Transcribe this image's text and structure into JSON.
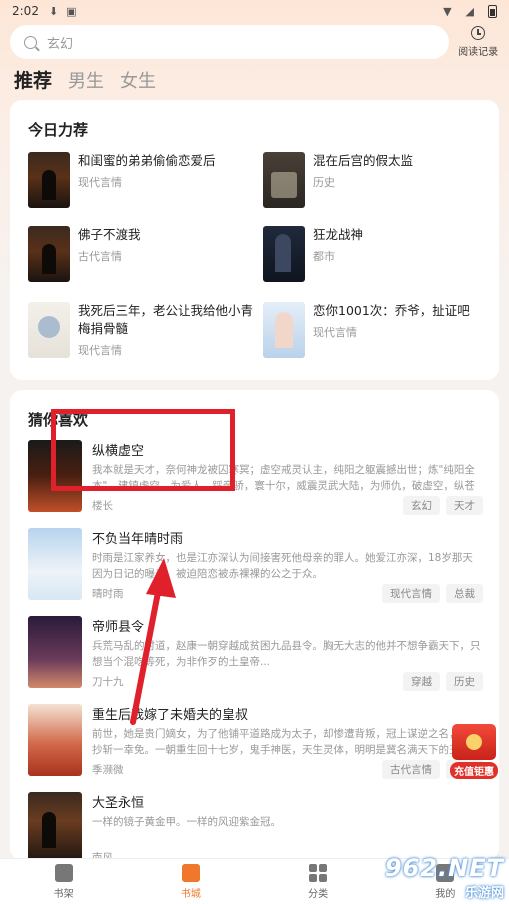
{
  "status_bar": {
    "time": "2:02"
  },
  "search": {
    "placeholder": "玄幻",
    "history_label": "阅读记录"
  },
  "tabs": [
    {
      "label": "推荐",
      "active": true
    },
    {
      "label": "男生",
      "active": false
    },
    {
      "label": "女生",
      "active": false
    }
  ],
  "recommend": {
    "title": "今日力荐",
    "items": [
      {
        "title": "和闺蜜的弟弟偷偷恋爱后",
        "category": "现代言情",
        "cover": "dark-castle"
      },
      {
        "title": "混在后宫的假太监",
        "category": "历史",
        "cover": "sepia"
      },
      {
        "title": "佛子不渡我",
        "category": "古代言情",
        "cover": "dark-castle"
      },
      {
        "title": "狂龙战神",
        "category": "都市",
        "cover": "navy"
      },
      {
        "title": "我死后三年，老公让我给他小青梅捐骨髓",
        "category": "现代言情",
        "cover": "pale"
      },
      {
        "title": "恋你1001次：乔爷，扯证吧",
        "category": "现代言情",
        "cover": "blue"
      }
    ]
  },
  "guess": {
    "title": "猜你喜欢",
    "items": [
      {
        "title": "纵横虚空",
        "desc": "我本就是天才，奈何神龙被囚寒冥；虚空戒灵认主，纯阳之躯震撼出世；炼\"纯阳全本\"，建镇虚空，为爱人，踩帝骄，寰十尔，威震灵武大陆，为师仇，破虚空，纵苍穹",
        "author": "楼长",
        "tags": [
          "玄幻",
          "天才"
        ],
        "cover": "fire"
      },
      {
        "title": "不负当年晴时雨",
        "desc": "时雨是江家养女，也是江亦深认为间接害死他母亲的罪人。她爱江亦深，18岁那天因为日记的曝光，被迫陪恋被赤裸裸的公之于众。",
        "author": "晴时雨",
        "tags": [
          "现代言情",
          "总裁"
        ],
        "cover": "sky"
      },
      {
        "title": "帝师县令",
        "desc": "兵荒马乱的时道，赵康一朝穿越成贫困九品县令。胸无大志的他并不想争霸天下，只想当个混吃等死，为非作歹的土皇帝...",
        "author": "刀十九",
        "tags": [
          "穿越",
          "历史"
        ],
        "cover": "purple"
      },
      {
        "title": "重生后我嫁了未婚夫的皇叔",
        "desc": "前世，她是贵门嫡女，为了他铺平道路成为太子，却惨遭背叛，冠上谋逆之名，满门抄斩一幸免。一朝重生回十七岁，鬼手神医，天生灵体，明明是冀名满天下的丑女，...",
        "author": "季濒微",
        "tags": [
          "古代言情",
          "重生"
        ],
        "cover": "red"
      },
      {
        "title": "大圣永恒",
        "desc": "一样的镜子黄金甲。一样的风迎紫金冠。",
        "author": "南风",
        "tags": [],
        "cover": "castle"
      }
    ]
  },
  "bottom_nav": [
    {
      "label": "书架",
      "active": false
    },
    {
      "label": "书城",
      "active": true
    },
    {
      "label": "分类",
      "active": false
    },
    {
      "label": "我的",
      "active": false
    }
  ],
  "promo": {
    "label": "充值钜惠"
  },
  "watermark": {
    "big": "962.NET",
    "small": "乐游网"
  },
  "colors": {
    "accent": "#f0782c",
    "annotation": "#e0202a"
  }
}
